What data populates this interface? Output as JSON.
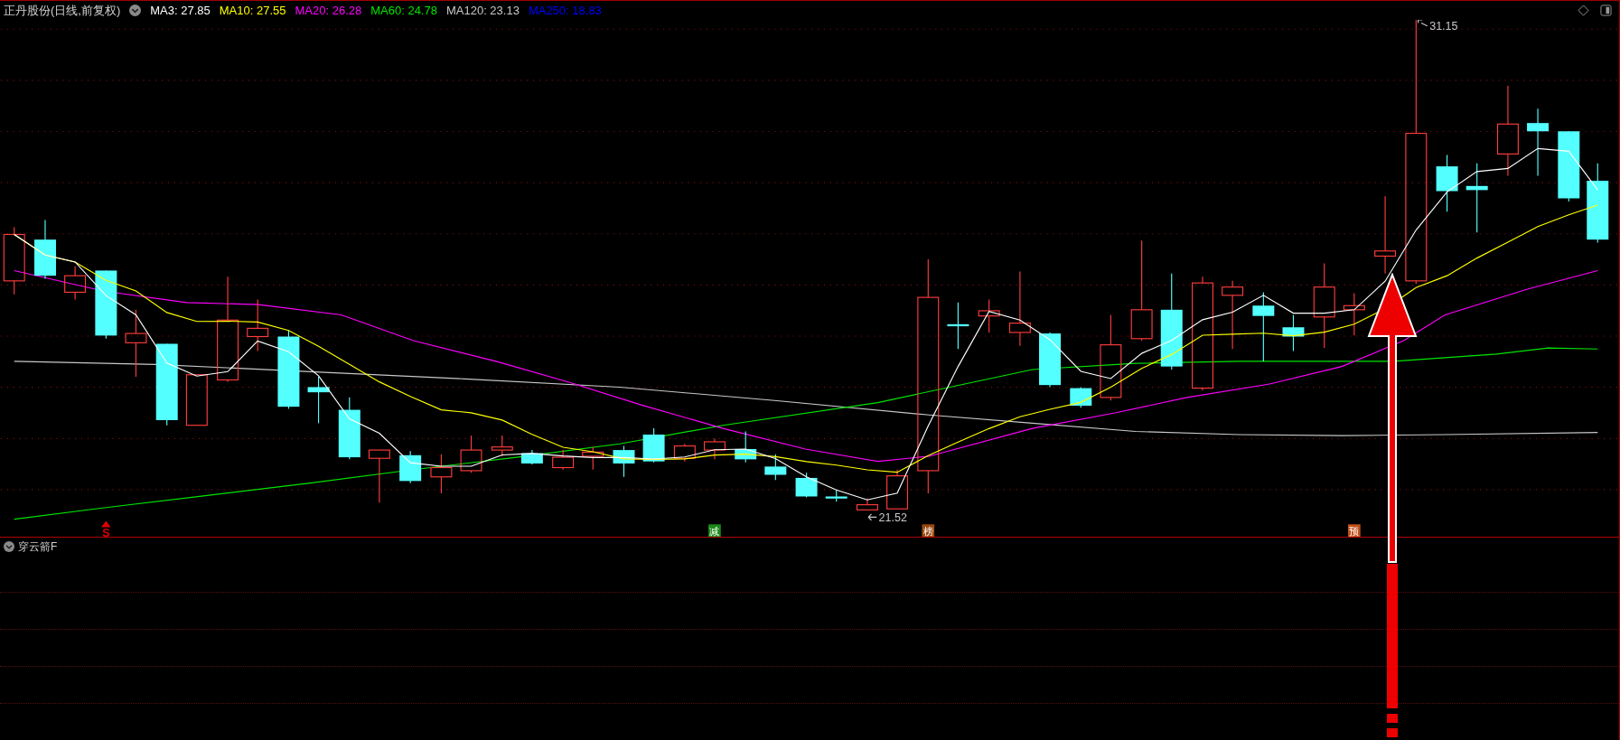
{
  "header": {
    "title": "正丹股份(日线,前复权)",
    "indicators": [
      {
        "label": "MA3: 27.85",
        "color": "#ffffff"
      },
      {
        "label": "MA10: 27.55",
        "color": "#ffff00"
      },
      {
        "label": "MA20: 26.28",
        "color": "#ff00ff"
      },
      {
        "label": "MA60: 24.78",
        "color": "#00e600"
      },
      {
        "label": "MA120: 23.13",
        "color": "#c8c8c8"
      },
      {
        "label": "MA250: 18.83",
        "color": "#0000ff"
      }
    ]
  },
  "main_chart": {
    "high_label": "31.15",
    "low_label": "21.52",
    "signals": [
      {
        "label": "S",
        "kind": "text",
        "color": "#e00000"
      },
      {
        "label": "减",
        "kind": "badge",
        "color": "#1a8a1a"
      },
      {
        "label": "榜",
        "kind": "badge",
        "color": "#9a4a12"
      },
      {
        "label": "预",
        "kind": "badge",
        "color": "#c0501a"
      }
    ]
  },
  "sub_chart": {
    "title": "穿云箭F"
  }
}
